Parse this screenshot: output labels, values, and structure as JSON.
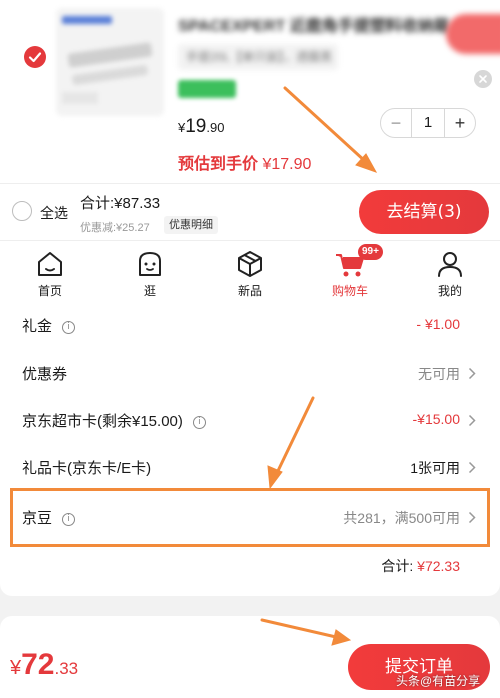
{
  "product": {
    "title": "SPACEXPERT 近鹿角手提塑料收纳箱",
    "spec": "手提20L【单只装】，透膜黑",
    "price_currency": "¥",
    "price_int": "19",
    "price_dec": ".90",
    "quantity": "1",
    "minus": "−",
    "plus": "+",
    "est_label": "预估到手价",
    "est_value": "¥17.90"
  },
  "checkout_bar": {
    "select_all": "全选",
    "total": "合计:¥87.33",
    "discount": "优惠减:¥25.27",
    "detail": "优惠明细",
    "checkout_button": "去结算(3)"
  },
  "tabs": [
    {
      "label": "首页",
      "icon": "home-icon"
    },
    {
      "label": "逛",
      "icon": "face-icon"
    },
    {
      "label": "新品",
      "icon": "box-icon"
    },
    {
      "label": "购物车",
      "icon": "cart-icon",
      "badge": "99+"
    },
    {
      "label": "我的",
      "icon": "user-icon"
    }
  ],
  "options": [
    {
      "label": "礼金",
      "value": "- ¥1.00"
    },
    {
      "label": "优惠券",
      "value": "无可用"
    },
    {
      "label": "京东超市卡(剩余¥15.00)",
      "value": "-¥15.00"
    },
    {
      "label": "礼品卡(京东卡/E卡)",
      "value": "1张可用"
    },
    {
      "label": "京豆",
      "value": "共281，满500可用"
    }
  ],
  "subtotal": {
    "label": "合计: ",
    "value": "¥72.33"
  },
  "submit": {
    "currency": "¥",
    "int": "72",
    "dec": ".33",
    "button": "提交订单"
  },
  "watermark": "头条@有苗分享",
  "colors": {
    "accent": "#e4393c",
    "annotation": "#f28a3a"
  }
}
